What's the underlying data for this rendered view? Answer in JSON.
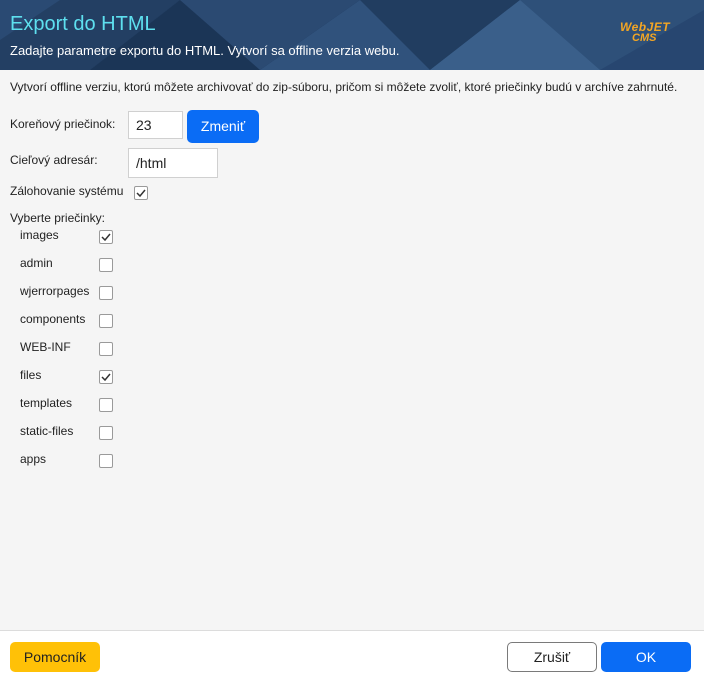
{
  "header": {
    "title": "Export do HTML",
    "subtitle": "Zadajte parametre exportu do HTML. Vytvorí sa offline verzia webu.",
    "logo_line1": "WebJET",
    "logo_line2": "CMS"
  },
  "intro": "Vytvorí offline verziu, ktorú môžete archivovať do zip-súboru, pričom si môžete zvoliť, ktoré priečinky budú v archíve zahrnuté.",
  "form": {
    "root_label": "Koreňový priečinok:",
    "root_value": "23",
    "change_button": "Zmeniť",
    "target_label": "Cieľový adresár:",
    "target_value": "/html",
    "backup_label": "Zálohovanie systému",
    "backup_checked": true,
    "folders_label": "Vyberte priečinky:",
    "folders": [
      {
        "name": "images",
        "checked": true
      },
      {
        "name": "admin",
        "checked": false
      },
      {
        "name": "wjerrorpages",
        "checked": false
      },
      {
        "name": "components",
        "checked": false
      },
      {
        "name": "WEB-INF",
        "checked": false
      },
      {
        "name": "files",
        "checked": true
      },
      {
        "name": "templates",
        "checked": false
      },
      {
        "name": "static-files",
        "checked": false
      },
      {
        "name": "apps",
        "checked": false
      }
    ]
  },
  "footer": {
    "help_button": "Pomocník",
    "cancel_button": "Zrušiť",
    "ok_button": "OK"
  },
  "colors": {
    "header_bg": "#1f3c5e",
    "title": "#5ee0ef",
    "primary": "#0a6cf5",
    "help": "#ffc107",
    "logo": "#f4a623"
  }
}
